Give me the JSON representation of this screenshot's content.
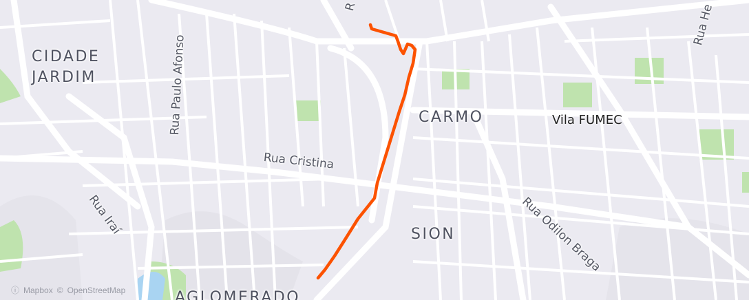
{
  "map": {
    "areas": [
      "CIDADE",
      "JARDIM",
      "CARMO",
      "SION",
      "AGLOMERADO"
    ],
    "streets": [
      "Rua Paulo Afonso",
      "Rua Cristina",
      "Rua Iraí",
      "Rua Odilon Braga",
      "Rua He",
      "R"
    ],
    "pois": [
      "Vila FUMEC"
    ],
    "attribution": {
      "mapbox": "Mapbox",
      "osm": "OpenStreetMap",
      "mapbox_icon": "info-circle-icon",
      "osm_icon": "copyright-icon"
    },
    "colors": {
      "background": "#ebeaf1",
      "roads": "#ffffff",
      "parks": "#bfe3ae",
      "water": "#a9d4f2",
      "route": "#fc5200"
    }
  }
}
